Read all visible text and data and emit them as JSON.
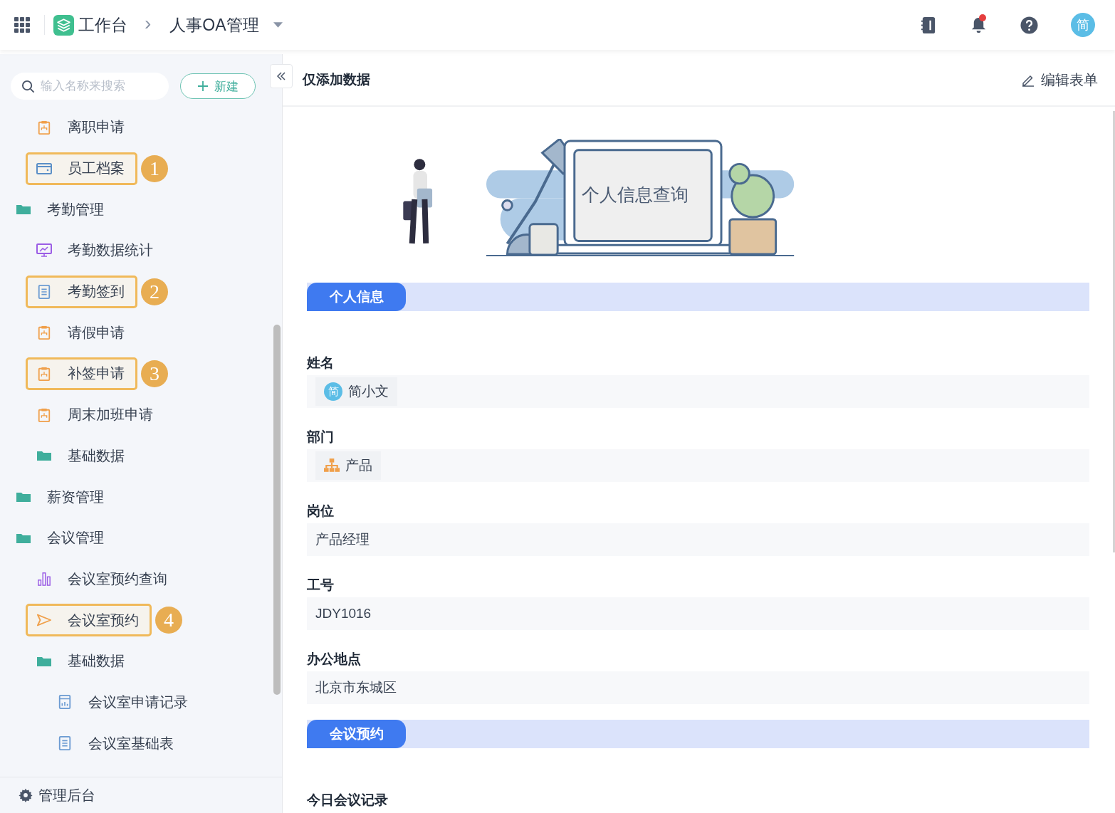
{
  "topbar": {
    "workspace": "工作台",
    "breadcrumb_separator": "›",
    "app": "人事OA管理",
    "has_notification": true,
    "avatar": "简"
  },
  "sidebar": {
    "search": {
      "placeholder": "输入名称来搜索"
    },
    "new_button": "新建",
    "leading_items": [
      {
        "label": "离职申请",
        "kind": "form"
      },
      {
        "label": "员工档案",
        "kind": "card",
        "callout": "1"
      }
    ],
    "items": [
      {
        "label": "考勤管理",
        "kind": "folder",
        "children": [
          {
            "label": "考勤数据统计",
            "kind": "monitor"
          },
          {
            "label": "考勤签到",
            "kind": "doc",
            "callout": "2"
          },
          {
            "label": "请假申请",
            "kind": "form"
          },
          {
            "label": "补签申请",
            "kind": "form",
            "callout": "3"
          },
          {
            "label": "周末加班申请",
            "kind": "form"
          },
          {
            "label": "基础数据",
            "kind": "folder"
          }
        ]
      },
      {
        "label": "薪资管理",
        "kind": "folder"
      },
      {
        "label": "会议管理",
        "kind": "folder",
        "children": [
          {
            "label": "会议室预约查询",
            "kind": "bars"
          },
          {
            "label": "会议室预约",
            "kind": "send",
            "callout": "4"
          },
          {
            "label": "基础数据",
            "kind": "folder",
            "children": [
              {
                "label": "会议室申请记录",
                "kind": "report"
              },
              {
                "label": "会议室基础表",
                "kind": "doc"
              }
            ]
          }
        ]
      }
    ],
    "footer": "管理后台"
  },
  "form": {
    "title": "仅添加数据",
    "edit_button": "编辑表单",
    "banner_text": "个人信息查询",
    "sections": [
      {
        "title": "个人信息",
        "fields": [
          {
            "label": "姓名",
            "kind": "user",
            "avatar": "简",
            "value": "简小文"
          },
          {
            "label": "部门",
            "kind": "dept",
            "value": "产品"
          },
          {
            "label": "岗位",
            "kind": "text",
            "value": "产品经理"
          },
          {
            "label": "工号",
            "kind": "text",
            "value": "JDY1016"
          },
          {
            "label": "办公地点",
            "kind": "text",
            "value": "北京市东城区"
          }
        ]
      },
      {
        "title": "会议预约",
        "fields": [
          {
            "label": "今日会议记录",
            "kind": "label"
          }
        ]
      }
    ]
  }
}
